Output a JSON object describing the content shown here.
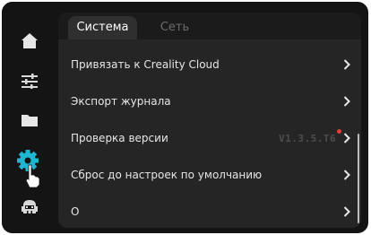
{
  "sidebar": {
    "items": [
      {
        "icon": "home-icon",
        "active": false
      },
      {
        "icon": "sliders-icon",
        "active": false
      },
      {
        "icon": "folder-icon",
        "active": false
      },
      {
        "icon": "gear-icon",
        "active": true
      },
      {
        "icon": "robot-icon",
        "active": false
      }
    ],
    "accent_color": "#1fb6d1"
  },
  "tabs": [
    {
      "label": "Система",
      "active": true
    },
    {
      "label": "Сеть",
      "active": false
    }
  ],
  "settings": {
    "items": [
      {
        "label": "Привязать к Creality Cloud"
      },
      {
        "label": "Экспорт журнала"
      },
      {
        "label": "Проверка версии",
        "version": "V1.3.5.T6",
        "update_available": true
      },
      {
        "label": "Сброс до настроек по умолчанию"
      },
      {
        "label": "О"
      }
    ]
  },
  "colors": {
    "background": "#141414",
    "panel": "#252525",
    "text": "#e6e6e6",
    "inactive_tab": "#6b6b6b",
    "update_badge": "#e53b3b"
  }
}
